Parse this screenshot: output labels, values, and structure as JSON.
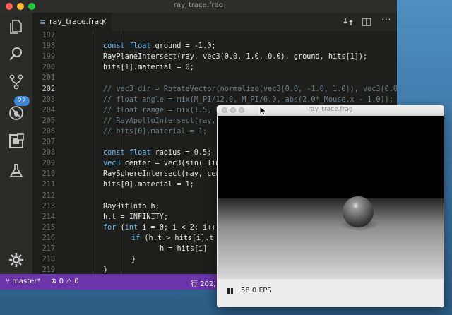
{
  "vscode": {
    "title": "ray_trace.frag",
    "activity_badge": "22",
    "tab": {
      "icon": "≡",
      "label": "ray_trace.frag",
      "close": "×"
    },
    "editor_lines": [
      {
        "num": "197",
        "indent": 0,
        "parts": []
      },
      {
        "num": "198",
        "indent": 1,
        "parts": [
          [
            "k",
            "const float"
          ],
          [
            "n",
            " ground = -1.0;"
          ]
        ]
      },
      {
        "num": "199",
        "indent": 1,
        "parts": [
          [
            "n",
            "RayPlaneIntersect(ray, vec3(0.0, 1.0, 0.0), ground, hits[1]);"
          ]
        ]
      },
      {
        "num": "200",
        "indent": 1,
        "parts": [
          [
            "n",
            "hits[1].material = 0;"
          ]
        ]
      },
      {
        "num": "201",
        "indent": 0,
        "parts": []
      },
      {
        "num": "202",
        "indent": 1,
        "current": true,
        "parts": [
          [
            "c",
            "// vec3 dir = RotateVector(normalize(vec3(0.0, -1.0, 1.0)), vec3(0.0,"
          ]
        ]
      },
      {
        "num": "203",
        "indent": 1,
        "parts": [
          [
            "c",
            "// float angle = mix(M_PI/12.0, M_PI/6.0, abs(2.0*_Mouse.x - 1.0));"
          ]
        ]
      },
      {
        "num": "204",
        "indent": 1,
        "parts": [
          [
            "c",
            "// float range = mix(1.5, 0"
          ]
        ]
      },
      {
        "num": "205",
        "indent": 1,
        "parts": [
          [
            "c",
            "// RayApolloIntersect(ray,"
          ]
        ]
      },
      {
        "num": "206",
        "indent": 1,
        "parts": [
          [
            "c",
            "// hits[0].material = 1;"
          ]
        ]
      },
      {
        "num": "207",
        "indent": 0,
        "parts": []
      },
      {
        "num": "208",
        "indent": 1,
        "parts": [
          [
            "k",
            "const float"
          ],
          [
            "n",
            " radius = 0.5;"
          ]
        ]
      },
      {
        "num": "209",
        "indent": 1,
        "parts": [
          [
            "k",
            "vec3"
          ],
          [
            "n",
            " center = vec3(sin(_Tim"
          ]
        ]
      },
      {
        "num": "210",
        "indent": 1,
        "parts": [
          [
            "n",
            "RaySphereIntersect(ray, cen"
          ]
        ]
      },
      {
        "num": "211",
        "indent": 1,
        "parts": [
          [
            "n",
            "hits[0].material = 1;"
          ]
        ]
      },
      {
        "num": "212",
        "indent": 0,
        "parts": []
      },
      {
        "num": "213",
        "indent": 1,
        "parts": [
          [
            "n",
            "RayHitInfo h;"
          ]
        ]
      },
      {
        "num": "214",
        "indent": 1,
        "parts": [
          [
            "n",
            "h.t = INFINITY;"
          ]
        ]
      },
      {
        "num": "215",
        "indent": 1,
        "parts": [
          [
            "k",
            "for"
          ],
          [
            "n",
            " ("
          ],
          [
            "k",
            "int"
          ],
          [
            "n",
            " i = 0; i < 2; i++)"
          ]
        ]
      },
      {
        "num": "216",
        "indent": 2,
        "parts": [
          [
            "k",
            "if"
          ],
          [
            "n",
            " (h.t > hits[i].t"
          ]
        ]
      },
      {
        "num": "217",
        "indent": 3,
        "parts": [
          [
            "n",
            "h = hits[i]"
          ]
        ]
      },
      {
        "num": "218",
        "indent": 2,
        "parts": [
          [
            "n",
            "}"
          ]
        ]
      },
      {
        "num": "219",
        "indent": 1,
        "parts": [
          [
            "n",
            "}"
          ]
        ]
      }
    ],
    "status": {
      "branch": "master*",
      "errors": "0",
      "warnings": "0",
      "position": "行 202,"
    },
    "colors": {
      "statusbar": "#6a35a8",
      "keyword": "#66bef0",
      "comment": "#6d7d8a"
    }
  },
  "shader_window": {
    "title": "ray_trace.frag",
    "fps": "58.0 FPS",
    "pause_icon": "pause-icon"
  }
}
